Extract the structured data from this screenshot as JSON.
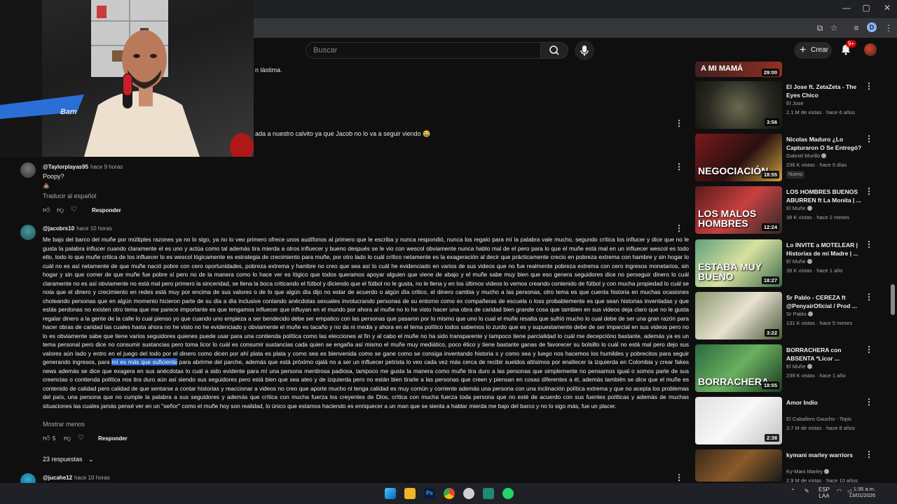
{
  "browser": {
    "window_controls": [
      "—",
      "▢",
      "✕"
    ],
    "profile_initial": "D"
  },
  "header": {
    "search_placeholder": "Buscar",
    "create_label": "Crear",
    "notifications_badge": "9+"
  },
  "webcam": {
    "overlay_text": "Bam"
  },
  "comments": {
    "fragments": [
      "n lástima.",
      "ada a nuestro calvito ya que Jacob no lo va a seguir viendo 😂"
    ],
    "items": [
      {
        "handle": "@Taylorplayas95",
        "time": "hace 9 horas",
        "text": "Poopy?",
        "emoji": "💩",
        "translate": "Traducir al español",
        "reply_label": "Responder"
      },
      {
        "handle": "@jacobrs10",
        "time": "hace 10 horas",
        "body_before": "Me bajo del barco del muñe por múltiples razones ya no lo sigo, ya no lo veo primero ofrece unos audífonos al primero que le escriba y nunca respondió, nunca los regalo para mí la palabra vale mucho, segundo crítica los influcer y dice que no le gusta la palabra influcer cuando claramente el es uno y actúa como tal además tira mierda a otros influecer y bueno después se le vio con wescol obviamente nunca hablo mal de el pero para lo que el muñe está mal en un influecer wescol es todo ello, todo lo que muñe critica de los influecer lo es wescol lógicamente es estrategia de crecimiento para muñe, por otro lado lo cuál crítico netamente es la exageración al decir que prácticamente crecio en pobreza extrema con hambre y sin hogar lo cuál no es así netamente de que muñe nació pobre con cero oportunidades, pobreza extrema y hambre no creo que sea así lo cuál he evidenciado en varios de sus videos que no fue realmente pobreza extrema con cero ingresos monetarios, sin hogar y sin que comer de que muñe fue pobre sí pero no de la manera como lo hace ver es lógico que todos queramos apoyar alguien que viene de abajo y el muñe sabe muy bien que eso genera seguidores dice no perseguir dinero lo cuál claramente no es así obviamente no está mal pero primero la sinceridad, se llena la boca criticando el fútbol y diciendo que el fútbol no le gusta, no le llena y en los últimos videos lo vemos creando contenido de fútbol y con mucha propiedad lo cuál se nota que el dinero y crecimiento en redes está muy por encima de sus valores o de lo que algún día dijo no estar de acuerdo o algún día critico, el dinero cambia y mucho a las personas, otro tema es que cuenta historia en muchas ocasiones choteando personas que en algún momento hicieron parte de su día a día inclusive contando anécdotas sexuales involucrando personas de su entorno como ex compañeras de escuela o loss probablemente es que sean historias inventadas y que estás perdonas no existen otro tema que me parece importante es que tengamos influecer que influyan en el mundo por ahora al muñe no lo he visto hacer una obra de caridad bien grande cosa que tambien en sus videos deja claro que no le gusta regalar dinero a la gente de la calle lo cual pienso yo que cuando uno empieza a ser bendecido debe ser empatico con las personas que pasaron por lo mismo que uno lo cual el muñe resalta que sufrió mucho lo cual debe de ser una gran razón para hacer obras de caridad las cuales hasta ahora no he visto no he evidenciado y obviamente el muñe es tacaño y no da ni media y ahora en el tema político todos sabemos lo zurdo que es y supuestamente debe de ser imparcial en sus videos pero no lo es obviamente sabe que tiene varios seguidores quienes puede usar para una contienda política como las elecciones al fin y al cabo el muñe no ha sido transparente y tampoco tiene parcialidad lo cuál me decepcióno bastante, además ya es un tema personal pero dice no consumir sustancias pero toma licor lo cuál es consumir sustancias cada quien se engaña así mismo el muñe muy mediático, poco ético y tiene bastante ganas de favorecer su bolsillo lo cuál no está mal pero dejo sus valores aún lado y entro en el juego del todo por el dinero como dicen por ahí plata es plata y como sea es bienvenida como se gane como se consiga inventando historia s y como sea y luego nos hacemos los humildes y pobrecitos para seguir generando ingresos, para ",
        "body_highlight": "mí es más que suficiente",
        "body_after": " para abrirme del parche, además que está próximo ojalá no a ser un influecer petrista lo veo cada vez más cerca de recibir sueldos altísimos por enaltecer la izquierda en Colombia y crear fakes news además se dice que exagera en sus anécdotas lo cuál a sido evidente para mí una persona mentirosa padiosa, tampoco me gusta la manera como muñe tira duro a las personas que simplemente no pensamos igual o somos parte de sus creencias o contienda política nos tira duro aún así siendo sus seguidores pero está bien que sea ateo y de izquierda pero no están bien tirarle a las personas que creen y piensan en cosas diferentes a él, además también se dice que el muñe es contenido de calidad pero calidad de que sentarse a contar historias y reaccionar a videos no creo que aporte mucho ni tenga calidad es muy común y corriente además una persona con una inclinación política extrema y que no acepta los problemas del país, una persona que no cumple la palabra a sus seguidores y además que crítica con mucha fuerza los creyentes de Dios, crítica con mucha fuerza toda persona que no esté de acuerdo con sus fuentes políticas y además de muchas situaciones las cuales jamás pensé ver en un \"señor\" como el muñe hoy son realidad, lo único que estamos haciendo es enriquecer a un man que se sienta a hablar mierda me bajo del barco y no lo sigo más, fue un placer.",
        "show_less": "Mostrar menos",
        "likes": "5",
        "reply_label": "Responder",
        "replies": "23 respuestas"
      },
      {
        "handle": "@jucahe12",
        "time": "hace 10 horas"
      }
    ]
  },
  "sidebar": {
    "top_thumb_text": "A MI MAMÁ",
    "top_thumb_duration": "29:00",
    "videos": [
      {
        "title": "El Jose ft. ZetaZeta - The Eyes Chico",
        "channel": "El Jose",
        "verified": false,
        "meta": "2.1 M de vistas · hace 6 años",
        "duration": "3:56",
        "overlay": ""
      },
      {
        "title": "Nicolas Maduro ¿Lo Capturaron O Se Entregó?",
        "channel": "Gabriel Murillo",
        "verified": true,
        "meta": "236 K vistas · hace 5 días",
        "badge": "Nuevo",
        "duration": "18:55",
        "overlay": "NEGOCIACIÓN"
      },
      {
        "title": "LOS HOMBRES BUENOS ABURREN ft La Monita | ...",
        "channel": "El Muñe",
        "verified": true,
        "meta": "38 K vistas · hace 2 meses",
        "duration": "12:24",
        "overlay": "LOS MALOS HOMBRES"
      },
      {
        "title": "Lo INVITE a MOTELEAR | Historias de mi Madre | ...",
        "channel": "El Muñe",
        "verified": true,
        "meta": "39 K vistas · hace 1 año",
        "duration": "18:27",
        "overlay": "ESTABA MUY BUENO"
      },
      {
        "title": "Sr Pablo - CEREZA ft @PenyairOficial  / Prod ...",
        "channel": "Sr Pablo",
        "verified": true,
        "meta": "131 K vistas · hace 5 meses",
        "duration": "3:22",
        "overlay": ""
      },
      {
        "title": "BORRACHERA con ABSENTA *Licor ...",
        "channel": "El Muñe",
        "verified": true,
        "meta": "239 K vistas · hace 1 año",
        "duration": "18:55",
        "overlay": "BORRACHERA"
      },
      {
        "title": "Amor Indio",
        "channel": "El Caballero Gaucho - Topic",
        "verified": false,
        "meta": "3.7 M de vistas · hace 8 años",
        "duration": "2:38",
        "overlay": ""
      },
      {
        "title": "kymani marley   warriors",
        "channel": "Ky-Mani Marley",
        "verified": true,
        "meta": "2.9 M de vistas · hace 10 años",
        "duration": "",
        "overlay": ""
      }
    ]
  },
  "taskbar": {
    "lang_line1": "ESP",
    "lang_line2": "LAA",
    "time": "1:35 a.m.",
    "date": "13/01/2026"
  },
  "colors": {
    "background": "#0f0f0f",
    "highlight": "#2a65c8",
    "notification": "#cc0000"
  }
}
